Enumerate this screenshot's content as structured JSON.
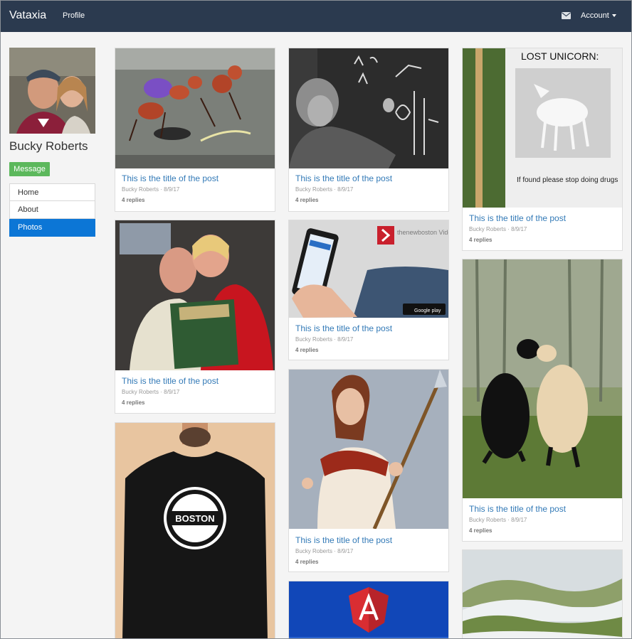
{
  "navbar": {
    "brand": "Vataxia",
    "profile_link": "Profile",
    "mail_icon": "envelope-icon",
    "account_label": "Account"
  },
  "sidebar": {
    "name": "Bucky Roberts",
    "message_button": "Message",
    "items": [
      {
        "label": "Home",
        "active": false
      },
      {
        "label": "About",
        "active": false
      },
      {
        "label": "Photos",
        "active": true
      }
    ]
  },
  "posts": [
    {
      "title": "This is the title of the post",
      "author": "Bucky Roberts",
      "date": "8/9/17",
      "meta": "Bucky Roberts · 8/9/17",
      "replies": "4 replies",
      "image": "ants-on-street"
    },
    {
      "title": "This is the title of the post",
      "author": "Bucky Roberts",
      "date": "8/9/17",
      "meta": "Bucky Roberts · 8/9/17",
      "replies": "4 replies",
      "image": "einstein-chalkboard"
    },
    {
      "title": "This is the title of the post",
      "author": "Bucky Roberts",
      "date": "8/9/17",
      "meta": "Bucky Roberts · 8/9/17",
      "replies": "4 replies",
      "image": "lost-unicorn-poster"
    },
    {
      "title": "This is the title of the post",
      "author": "Bucky Roberts",
      "date": "8/9/17",
      "meta": "Bucky Roberts · 8/9/17",
      "replies": "4 replies",
      "image": "couple-with-record"
    },
    {
      "title": "This is the title of the post",
      "author": "Bucky Roberts",
      "date": "8/9/17",
      "meta": "Bucky Roberts · 8/9/17",
      "replies": "4 replies",
      "image": "thenewboston-app-phone"
    },
    {
      "title": "This is the title of the post",
      "author": "Bucky Roberts",
      "date": "8/9/17",
      "meta": "Bucky Roberts · 8/9/17",
      "replies": "4 replies",
      "image": "bears"
    },
    {
      "title": "This is the title of the post",
      "author": "Bucky Roberts",
      "date": "8/9/17",
      "meta": "Bucky Roberts · 8/9/17",
      "replies": "4 replies",
      "image": "warrior-illustration"
    },
    {
      "image": "boston-tshirt"
    },
    {
      "image": "angular-logo"
    },
    {
      "image": "foggy-hills"
    }
  ],
  "image_text": {
    "unicorn_heading": "LOST UNICORN:",
    "unicorn_note": "If found please stop doing drugs",
    "tnb_label": "thenewboston Videos",
    "google_play": "Google play",
    "boston_label": "BOSTON"
  },
  "colors": {
    "navbar": "#2b3a4f",
    "primary": "#0c76d6",
    "link": "#337ab7",
    "success": "#5cb85c",
    "background": "#f4f4f4"
  }
}
